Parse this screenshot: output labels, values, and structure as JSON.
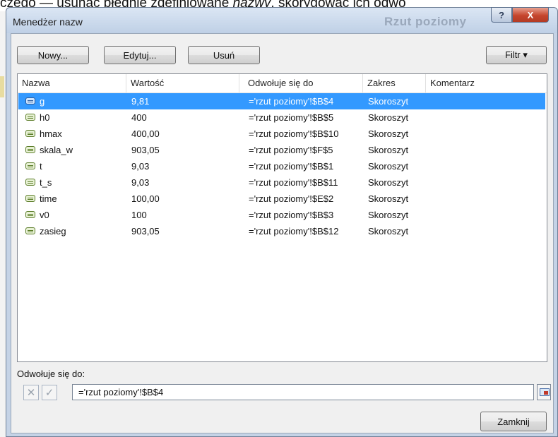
{
  "background": {
    "text_prefix": "czego — usunąć błędnie zdefiniowane ",
    "text_italic": "nazwy",
    "text_suffix": ", skorygować ich odwo",
    "ghost_title": "Rzut poziomy"
  },
  "dialog": {
    "title": "Menedżer nazw",
    "help_glyph": "?",
    "close_glyph": "X"
  },
  "toolbar": {
    "new_label": "Nowy...",
    "edit_label": "Edytuj...",
    "delete_label": "Usuń",
    "filter_label": "Filtr ▾"
  },
  "table": {
    "columns": [
      "Nazwa",
      "Wartość",
      "Odwołuje się do",
      "Zakres",
      "Komentarz"
    ],
    "rows": [
      {
        "name": "g",
        "value": "9,81",
        "ref": "='rzut poziomy'!$B$4",
        "scope": "Skoroszyt",
        "comment": "",
        "selected": true
      },
      {
        "name": "h0",
        "value": "400",
        "ref": "='rzut poziomy'!$B$5",
        "scope": "Skoroszyt",
        "comment": ""
      },
      {
        "name": "hmax",
        "value": "400,00",
        "ref": "='rzut poziomy'!$B$10",
        "scope": "Skoroszyt",
        "comment": ""
      },
      {
        "name": "skala_w",
        "value": "903,05",
        "ref": "='rzut poziomy'!$F$5",
        "scope": "Skoroszyt",
        "comment": ""
      },
      {
        "name": "t",
        "value": "9,03",
        "ref": "='rzut poziomy'!$B$1",
        "scope": "Skoroszyt",
        "comment": ""
      },
      {
        "name": "t_s",
        "value": "9,03",
        "ref": "='rzut poziomy'!$B$11",
        "scope": "Skoroszyt",
        "comment": ""
      },
      {
        "name": "time",
        "value": "100,00",
        "ref": "='rzut poziomy'!$E$2",
        "scope": "Skoroszyt",
        "comment": ""
      },
      {
        "name": "v0",
        "value": "100",
        "ref": "='rzut poziomy'!$B$3",
        "scope": "Skoroszyt",
        "comment": ""
      },
      {
        "name": "zasieg",
        "value": "903,05",
        "ref": "='rzut poziomy'!$B$12",
        "scope": "Skoroszyt",
        "comment": ""
      }
    ]
  },
  "refers_to": {
    "label": "Odwołuje się do:",
    "value": "='rzut poziomy'!$B$4"
  },
  "footer": {
    "close_label": "Zamknij"
  },
  "colors": {
    "selection": "#3399ff",
    "title_bar": "#c5d3e6",
    "close_button": "#c5452d"
  }
}
